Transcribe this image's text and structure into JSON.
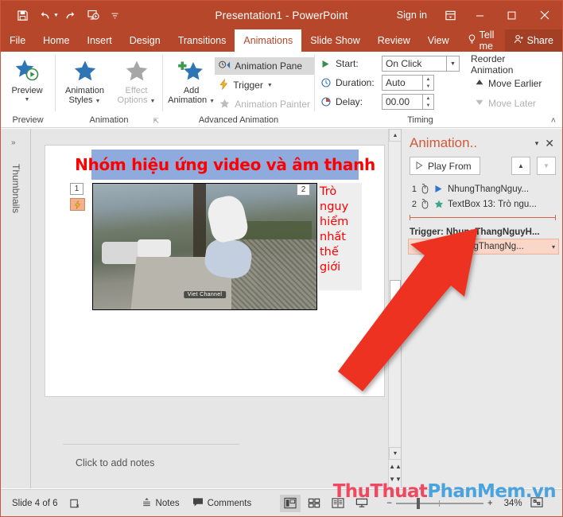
{
  "titlebar": {
    "document_title": "Presentation1  -  PowerPoint",
    "sign_in": "Sign in",
    "quick_access": [
      {
        "name": "save-icon",
        "label": "Save"
      },
      {
        "name": "undo-icon",
        "label": "Undo"
      },
      {
        "name": "redo-icon",
        "label": "Redo"
      },
      {
        "name": "start-presentation-icon",
        "label": "Start From Beginning"
      },
      {
        "name": "customize-qat-icon",
        "label": "Customize Quick Access Toolbar"
      }
    ],
    "ribbon_display_options": "Ribbon Display Options",
    "minimize": "─",
    "restore": "□",
    "close": "✕"
  },
  "tabs": [
    {
      "label": "File",
      "active": false
    },
    {
      "label": "Home",
      "active": false
    },
    {
      "label": "Insert",
      "active": false
    },
    {
      "label": "Design",
      "active": false
    },
    {
      "label": "Transitions",
      "active": false
    },
    {
      "label": "Animations",
      "active": true
    },
    {
      "label": "Slide Show",
      "active": false
    },
    {
      "label": "Review",
      "active": false
    },
    {
      "label": "View",
      "active": false
    }
  ],
  "tellme": "Tell me",
  "share": "Share",
  "ribbon": {
    "groups": {
      "preview": {
        "label": "Preview",
        "button": "Preview"
      },
      "animation": {
        "label": "Animation",
        "styles": "Animation\nStyles",
        "styles_line1": "Animation",
        "styles_line2": "Styles",
        "effect_line1": "Effect",
        "effect_line2": "Options",
        "dialog_launcher": "⬎"
      },
      "advanced": {
        "label": "Advanced Animation",
        "add_line1": "Add",
        "add_line2": "Animation",
        "animation_pane": "Animation Pane",
        "trigger": "Trigger",
        "animation_painter": "Animation Painter"
      },
      "timing": {
        "label": "Timing",
        "start_label": "Start:",
        "start_value": "On Click",
        "duration_label": "Duration:",
        "duration_value": "Auto",
        "delay_label": "Delay:",
        "delay_value": "00.00",
        "reorder_heading": "Reorder Animation",
        "move_earlier": "Move Earlier",
        "move_later": "Move Later"
      }
    },
    "collapse": "˄"
  },
  "thumbnails_panel": {
    "label": "Thumbnails",
    "expand": "»"
  },
  "slide": {
    "title": "Nhóm hiệu ứng video và âm thanh",
    "side_text": "Trò nguy hiểm nhất thế giới",
    "badge_1": "1",
    "badge_2": "2",
    "trigger_badge": "⚡",
    "video_watermark": "Viet Channel"
  },
  "animation_pane": {
    "title": "Animation..",
    "dropdown_caret": "▾",
    "close": "✕",
    "play_from": "Play From",
    "move_up": "▲",
    "move_down": "▼",
    "items": [
      {
        "num": "1",
        "icon": "play-triangle",
        "icon_glyph": "▶",
        "color": "#2e75d4",
        "text": "NhungThangNguy..."
      },
      {
        "num": "2",
        "icon": "star",
        "icon_glyph": "★",
        "color": "#3aa88a",
        "text": "TextBox 13: Trò ngu..."
      }
    ],
    "trigger_heading": "Trigger: NhungThangNguyH...",
    "trigger_item": {
      "num": "1",
      "icon": "pause-bars",
      "color": "#4a6fd4",
      "text": "NhungThangNg...",
      "caret": "▾"
    }
  },
  "notes": {
    "placeholder": "Click to add notes"
  },
  "statusbar": {
    "slide_counter": "Slide 4 of 6",
    "language_icon": "spell-check-icon",
    "notes_label": "Notes",
    "comments_label": "Comments",
    "views": [
      {
        "name": "normal-view",
        "active": true
      },
      {
        "name": "slide-sorter-view",
        "active": false
      },
      {
        "name": "reading-view",
        "active": false
      },
      {
        "name": "slide-show-view",
        "active": false
      }
    ],
    "zoom_out": "−",
    "zoom_in": "+",
    "zoom_percent": "34%",
    "fit_to_window": "fit-slide-icon"
  },
  "watermark": {
    "part1": "ThuThuat",
    "part2": "PhanMem.vn"
  },
  "colors": {
    "brand_red": "#b7472a",
    "title_block_blue": "#8faadc",
    "slide_text_red": "#ff0000",
    "trigger_row_bg": "#fad6c8",
    "annotation_arrow": "#ee3124"
  }
}
